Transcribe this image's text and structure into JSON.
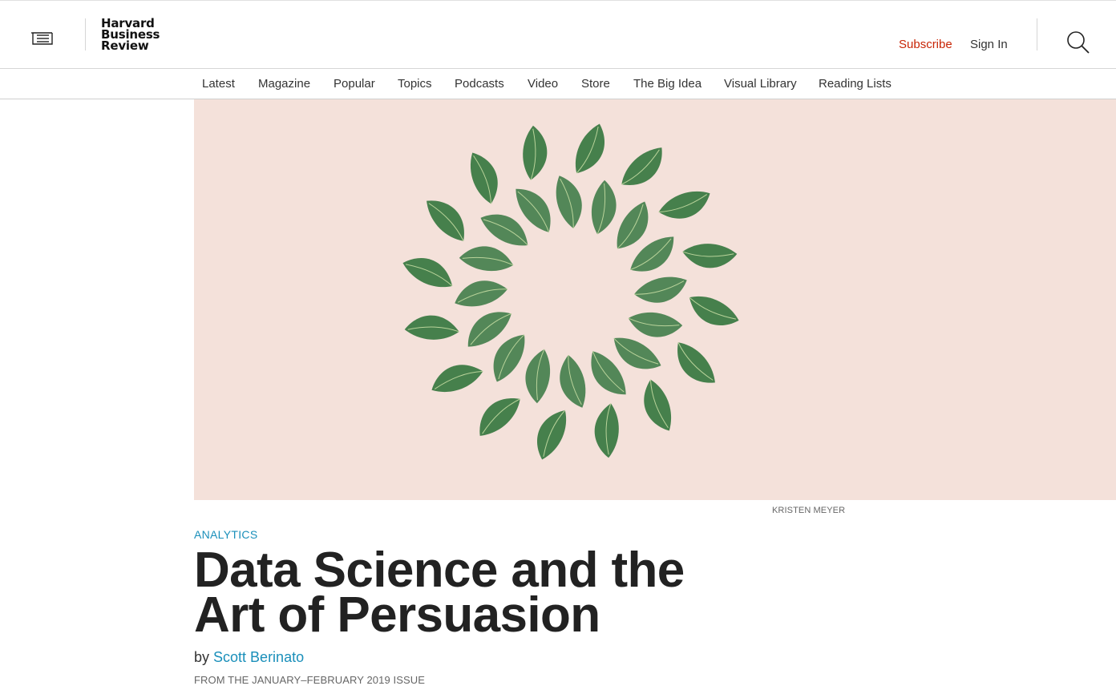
{
  "header": {
    "logo_lines": [
      "Harvard",
      "Business",
      "Review"
    ],
    "subscribe_label": "Subscribe",
    "signin_label": "Sign In"
  },
  "nav": {
    "items": [
      "Latest",
      "Magazine",
      "Popular",
      "Topics",
      "Podcasts",
      "Video",
      "Store",
      "The Big Idea",
      "Visual Library",
      "Reading Lists"
    ]
  },
  "hero": {
    "credit": "KRISTEN MEYER",
    "background_color": "#f4e1da",
    "leaf_color": "#3c7a45"
  },
  "article": {
    "topic": "ANALYTICS",
    "title_line1": "Data Science and the",
    "title_line2": "Art of Persuasion",
    "byline_prefix": "by",
    "author": "Scott Berinato",
    "issue": "FROM THE JANUARY–FEBRUARY 2019 ISSUE"
  },
  "colors": {
    "accent_red": "#c82506",
    "link_blue": "#1a8fba"
  }
}
